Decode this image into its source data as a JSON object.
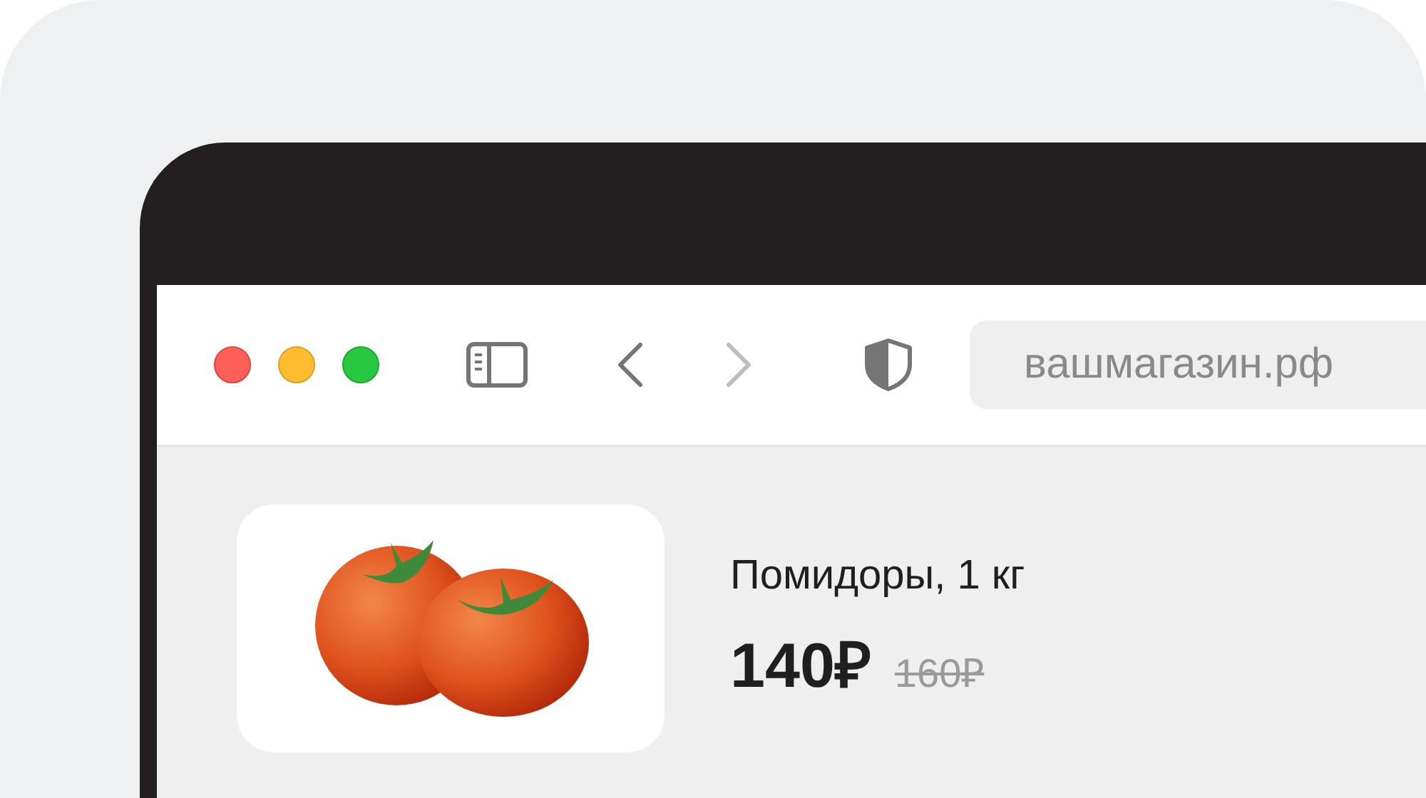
{
  "browser": {
    "nav": [
      {
        "kind": "back",
        "disabled": false
      },
      {
        "kind": "forward",
        "disabled": true
      }
    ],
    "address": {
      "value": "вашмагазин.рф"
    }
  },
  "product": {
    "name": "Помидоры, 1 кг",
    "price": "140₽",
    "old_price": "160₽"
  }
}
